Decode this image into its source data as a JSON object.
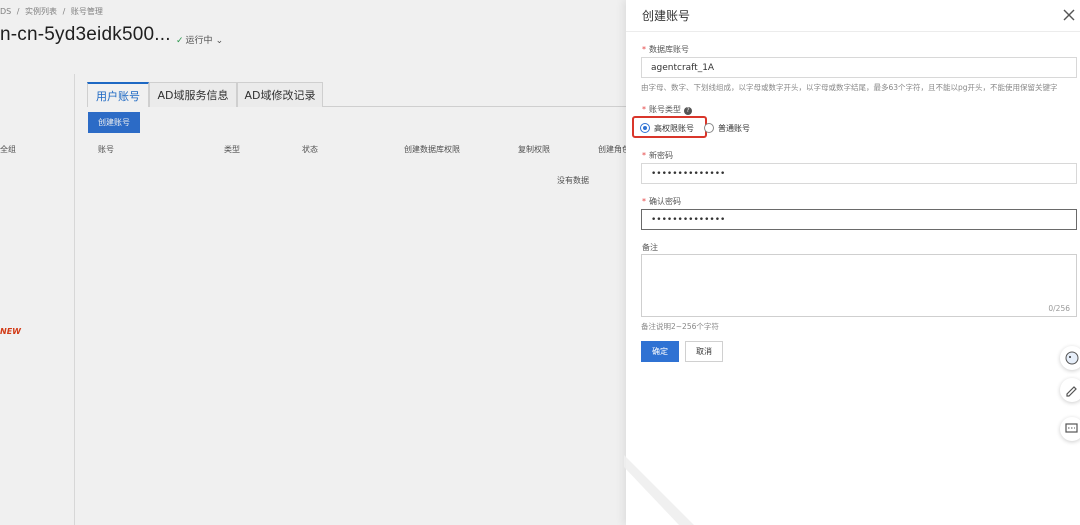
{
  "breadcrumb": [
    "DS",
    "/",
    "实例列表",
    "/",
    "账号管理"
  ],
  "instance": {
    "title": "n-cn-5yd3eidk500...",
    "status": "运行中"
  },
  "left_nav": {
    "fragments": [
      "全组"
    ],
    "new_badge": "NEW"
  },
  "tabs": [
    {
      "label": "用户账号",
      "active": true
    },
    {
      "label": "AD域服务信息",
      "active": false
    },
    {
      "label": "AD域修改记录",
      "active": false
    }
  ],
  "toolbar": {
    "create_label": "创建账号"
  },
  "table": {
    "columns": [
      "账号",
      "类型",
      "状态",
      "创建数据库权限",
      "复制权限",
      "创建角色"
    ],
    "empty_text": "没有数据"
  },
  "drawer": {
    "title": "创建账号",
    "account_name": {
      "label": "数据库账号",
      "value": "agentcraft_1A",
      "help": "由字母、数字、下划线组成，以字母或数字开头，以字母或数字结尾，最多63个字符，且不能以pg开头，不能使用保留关键字"
    },
    "account_type": {
      "label": "账号类型",
      "options": [
        {
          "label": "高权限账号",
          "checked": true
        },
        {
          "label": "普通账号",
          "checked": false
        }
      ]
    },
    "new_password": {
      "label": "新密码",
      "value": "••••••••••••••"
    },
    "confirm_password": {
      "label": "确认密码",
      "value": "••••••••••••••"
    },
    "remark": {
      "label": "备注",
      "counter": "0/256",
      "help": "备注说明2~256个字符"
    },
    "ok_label": "确定",
    "cancel_label": "取消"
  },
  "colors": {
    "primary": "#2f72d3",
    "highlight": "#d9362b",
    "required": "#e54545"
  }
}
